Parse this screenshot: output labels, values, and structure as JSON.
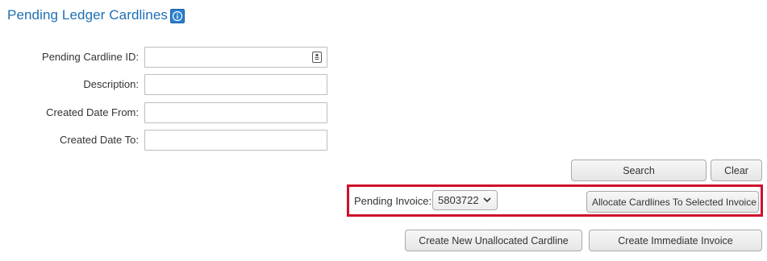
{
  "page": {
    "title": "Pending Ledger Cardlines"
  },
  "form": {
    "cardline_id_label": "Pending Cardline ID:",
    "description_label": "Description:",
    "date_from_label": "Created Date From:",
    "date_to_label": "Created Date To:",
    "cardline_id_value": "",
    "description_value": "",
    "date_from_value": "",
    "date_to_value": ""
  },
  "actions": {
    "search_label": "Search",
    "clear_label": "Clear"
  },
  "invoice": {
    "label": "Pending Invoice:",
    "selected": "5803722",
    "allocate_label": "Allocate Cardlines To Selected Invoice"
  },
  "footer": {
    "create_unallocated_label": "Create New Unallocated Cardline",
    "create_immediate_label": "Create Immediate Invoice"
  },
  "colors": {
    "title": "#1f6fb5",
    "highlight": "#d0102b",
    "info_icon": "#2b7fd0"
  },
  "icons": {
    "info": "info-icon",
    "lookup": "lookup-icon",
    "dropdown": "chevron-down-icon"
  }
}
